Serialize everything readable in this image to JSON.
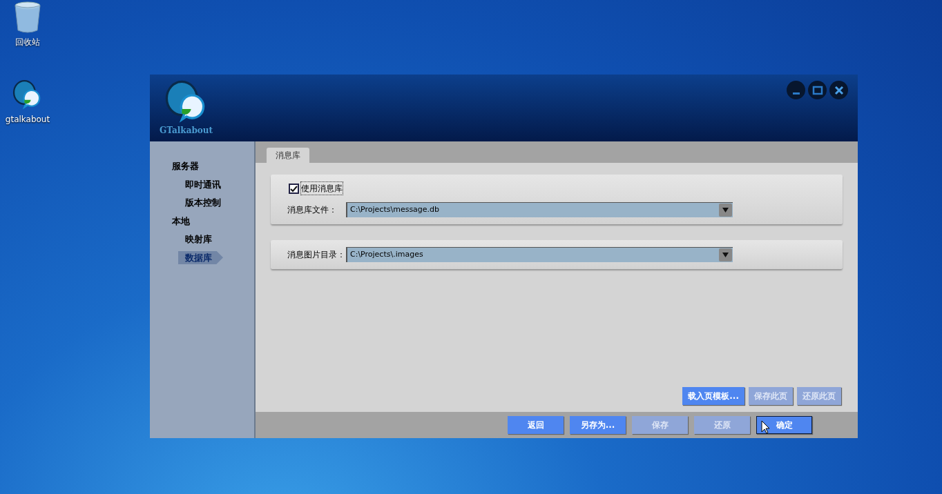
{
  "desktop_icons": [
    {
      "kind": "recycle",
      "label": "回收站"
    },
    {
      "kind": "app",
      "label": "gtalkabout"
    }
  ],
  "window": {
    "logo_text": "GTalkabout",
    "sidebar": {
      "items": [
        {
          "label": "服务器",
          "selected": false,
          "children": [
            {
              "label": "即时通讯",
              "selected": false
            },
            {
              "label": "版本控制",
              "selected": false
            }
          ]
        },
        {
          "label": "本地",
          "selected": false,
          "children": [
            {
              "label": "映射库",
              "selected": false
            },
            {
              "label": "数据库",
              "selected": true
            }
          ]
        }
      ]
    },
    "tabs": [
      {
        "label": "消息库",
        "selected": true
      }
    ],
    "groups": [
      {
        "checkbox": {
          "label": "使用消息库",
          "checked": true
        },
        "field": {
          "label": "消息库文件：",
          "value": "C:\\Projects\\message.db"
        }
      },
      {
        "field": {
          "label": "消息图片目录：",
          "value": "C:\\Projects\\.images"
        }
      }
    ],
    "page_buttons": [
      {
        "label": "载入页模板...",
        "disabled": false
      },
      {
        "label": "保存此页",
        "disabled": true
      },
      {
        "label": "还原此页",
        "disabled": true
      }
    ],
    "footer_buttons": [
      {
        "label": "返回",
        "disabled": false,
        "focused": false
      },
      {
        "label": "另存为...",
        "disabled": false,
        "focused": false
      },
      {
        "label": "保存",
        "disabled": true,
        "focused": false
      },
      {
        "label": "还原",
        "disabled": true,
        "focused": false
      },
      {
        "label": "确定",
        "disabled": false,
        "focused": true
      }
    ]
  }
}
